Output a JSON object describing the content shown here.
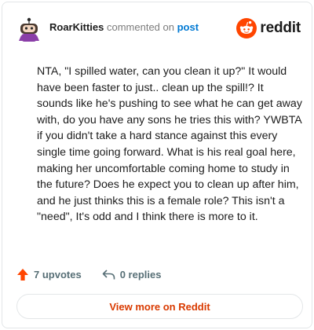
{
  "comment": {
    "author": "RoarKitties",
    "action_text": "commented on",
    "post_link": "post",
    "body": "NTA, \"I spilled water, can you clean it up?\" It would have been faster to just.. clean up the spill!? It sounds like he's pushing to see what he can get away with, do you have any sons he tries this with? YWBTA if you didn't take a hard stance against this every single time going forward. What is his real goal here, making her uncomfortable coming home to study in the future? Does he expect you to clean up after him, and he just thinks this is a female role? This isn't a \"need\", It's odd and I think there is more to it."
  },
  "brand": {
    "wordmark": "reddit",
    "icon": "reddit-snoo-icon",
    "color": "#ff4500"
  },
  "actions": {
    "upvotes_label": "7 upvotes",
    "upvote_icon": "upvote-arrow-icon",
    "replies_label": "0 replies",
    "reply_icon": "reply-arrow-icon"
  },
  "footer": {
    "view_more_label": "View more on Reddit"
  },
  "colors": {
    "link": "#0079d3",
    "upvote": "#ff4500",
    "view_more": "#d93a00"
  }
}
